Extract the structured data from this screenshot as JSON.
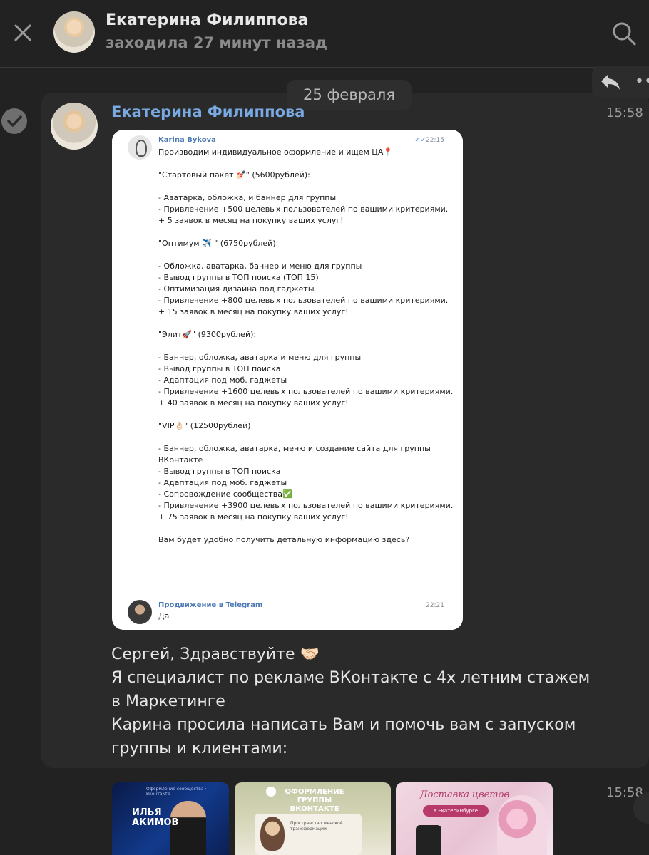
{
  "header": {
    "contact_name": "Екатерина Филиппова",
    "status": "заходила 27 минут назад"
  },
  "date_chip": "25 февраля",
  "message": {
    "author": "Екатерина Филиппова",
    "time": "15:58",
    "text_lines": [
      "Сергей, Здравствуйте 🤝🏻",
      "Я специалист по рекламе ВКонтакте с 4х летним стажем",
      "в Маркетинге",
      "Карина просила написать Вам и помочь вам с запуском",
      "группы и клиентами:"
    ]
  },
  "screenshot_message": {
    "sender": "Karina Bykova",
    "time": "22:15",
    "ticks": "✓✓",
    "body": "Производим индивидуальное оформление и ищем ЦА📍\n\n\"Стартовый пакет 💅🏻\" (5600рублей):\n\n- Аватарка, обложка, и баннер для группы\n- Привлечение +500 целевых пользователей по вашими критериями.\n+ 5 заявок в месяц на покупку ваших услуг!\n\n\"Оптимум ✈️ \" (6750рублей):\n\n- Обложка, аватарка, баннер и меню для группы\n- Вывод группы в ТОП поиска (ТОП 15)\n- Оптимизация дизайна под гаджеты\n- Привлечение +800 целевых пользователей по вашими критериями.\n+ 15 заявок в месяц на покупку ваших услуг!\n\n\"Элит🚀\" (9300рублей):\n\n- Баннер, обложка, аватарка и меню для группы\n- Вывод группы в ТОП поиска\n- Адаптация под моб. гаджеты\n- Привлечение +1600 целевых пользователей по вашими критериями.\n+ 40 заявок в месяц на покупку ваших услуг!\n\n\"VIP👌🏻\" (12500рублей)\n\n- Баннер, обложка, аватарка, меню и создание сайта для группы ВКонтакте\n- Вывод группы в ТОП поиска\n- Адаптация под моб. гаджеты\n- Сопровождение сообщества✅\n- Привлечение +3900 целевых пользователей по вашими критериями.\n+ 75 заявок в месяц на покупку ваших услуг!\n\nВам будет удобно получить детальную информацию здесь?",
    "reply_sender": "Продвижение в Telegram",
    "reply_time": "22:21",
    "reply_text": "Да"
  },
  "attachments": {
    "time": "15:58",
    "thumb1": {
      "small": "Оформление сообщества · Вконтакте",
      "title": "ИЛЬЯ\nАКИМОВ"
    },
    "thumb2": {
      "title": "ОФОРМЛЕНИЕ ГРУППЫ ВКОНТАКТЕ",
      "caption": "Пространство женской трансформации"
    },
    "thumb3": {
      "title": "Доставка цветов",
      "pill": "в Екатеринбурге"
    }
  },
  "icons": {
    "close": "close-icon",
    "search": "search-icon",
    "reply": "reply-icon",
    "more": "more-icon",
    "select": "check-icon"
  },
  "colors": {
    "background": "#222222",
    "author_link": "#79a9e2",
    "text": "#e6e6e6",
    "muted": "#8a8a8a"
  }
}
